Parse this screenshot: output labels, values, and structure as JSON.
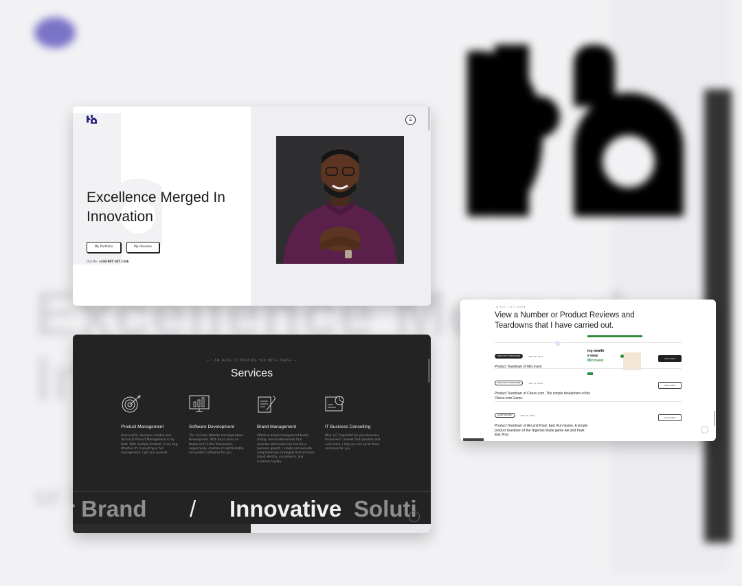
{
  "hero": {
    "title": "Excellence Merged In Innovation",
    "portfolio_button": "My Portfolio",
    "resume_button": "My Resume",
    "phone_label": "Dial Me:",
    "phone_number": "+234 907 107 1326"
  },
  "services": {
    "eyebrow": "— I AM HERE TO PROVIDE YOU WITH THESE —",
    "title": "Services",
    "items": [
      {
        "name": "Product Management",
        "description": "User-centric, Business minded and Technical Product Management is my forte. With multiple Products in my bag, Whether it's consulting or full management, I got you covered.",
        "icon": "target-icon"
      },
      {
        "name": "Software Development",
        "description": "This includes Website and Application Development. With focus areas on Nextjs and Flutter frameworks, respectively, creation of outstandable and perfect softwares for you.",
        "icon": "monitor-chart-icon"
      },
      {
        "name": "Brand Management",
        "description": "Effective brand management builds strong, memorable brands that resonate with audiences and drive business growth. I create and execute comprehensive strategies that enhance brand identity, consistency, and customer loyalty.",
        "icon": "brand-document-icon"
      },
      {
        "name": "IT Business Consulting",
        "description": "Why is IT important for your Business Processes? I answer that question and even more. I help you set up all these and more for you.",
        "icon": "consulting-chart-icon"
      }
    ],
    "marquee": [
      "ur Brand",
      "/",
      "Innovative",
      "Soluti"
    ]
  },
  "reviews": {
    "eyebrow": "WHAT I DO MAKE",
    "title": "View a Number or Product Reviews and Teardowns that I have carried out.",
    "items": [
      {
        "tag": "PRODUCT TEARDOWN",
        "date": "DEC 03, 2023",
        "name": "Product Teardown of Microvest",
        "button": "Learn More"
      },
      {
        "tag": "PRODUCT TEARDOWN",
        "date": "MAY 17, 2023",
        "name": "Product Teardown of Chess.com. The simple breakdown of the Chess.com Game.",
        "button": "Learn More"
      },
      {
        "tag": "GAME REVIEW",
        "date": "MAY 21, 2023",
        "name": "Product Teardown of Aki and Pawi: Epic Run Game. A simple product teardown of the Nigerian Made game Aki and Pawi: Epic Run.",
        "button": "Learn More"
      }
    ],
    "preview": {
      "line1": "ing wealth",
      "line2": "e easy",
      "brand": "Microvest",
      "button": "Learn More"
    }
  }
}
